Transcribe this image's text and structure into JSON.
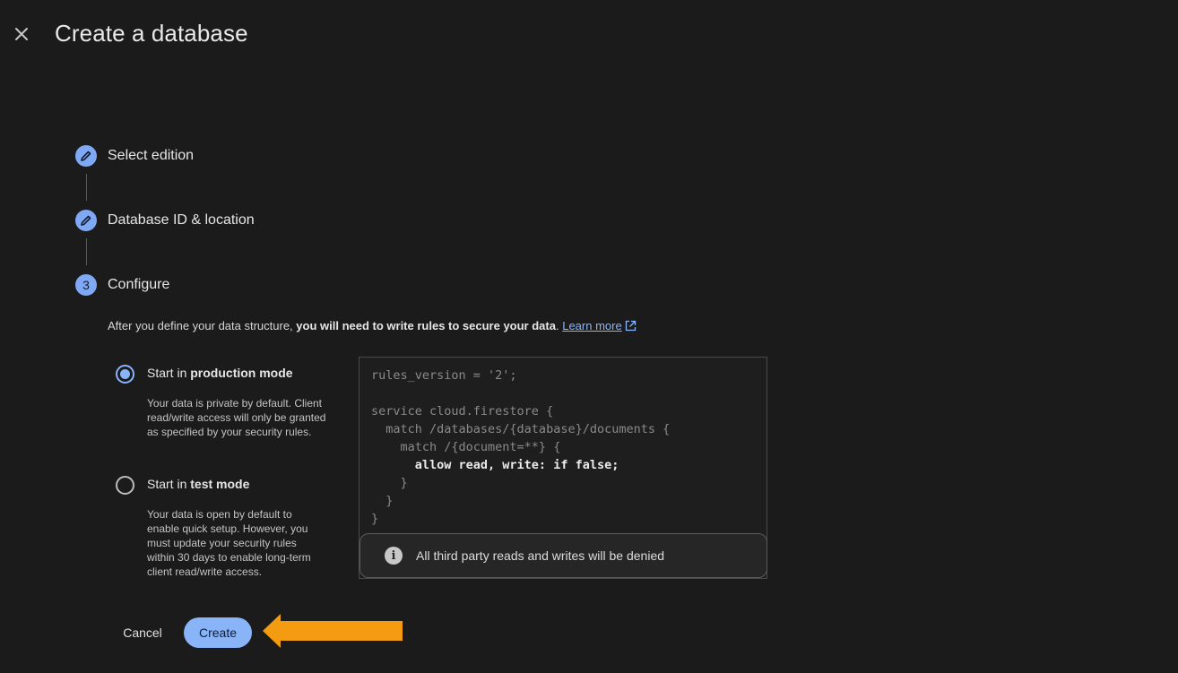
{
  "header": {
    "title": "Create a database"
  },
  "stepper": {
    "steps": [
      {
        "label": "Select edition",
        "state": "completed",
        "icon": "pencil-icon"
      },
      {
        "label": "Database ID & location",
        "state": "completed",
        "icon": "pencil-icon"
      },
      {
        "label": "Configure",
        "state": "active",
        "number": "3"
      }
    ]
  },
  "configure": {
    "description_plain": "After you define your data structure, ",
    "description_bold": "you will need to write rules to secure your data",
    "description_end": ".",
    "learn_more": "Learn more",
    "options": [
      {
        "title_prefix": "Start in ",
        "title_bold": "production mode",
        "selected": true,
        "description": "Your data is private by default. Client read/write access will only be granted as specified by your security rules."
      },
      {
        "title_prefix": "Start in ",
        "title_bold": "test mode",
        "selected": false,
        "description": "Your data is open by default to enable quick setup. However, you must update your security rules within 30 days to enable long-term client read/write access."
      }
    ],
    "code": {
      "lines": [
        "rules_version = '2';",
        "",
        "service cloud.firestore {",
        "  match /databases/{database}/documents {",
        "    match /{document=**} {",
        "      allow read, write: if false;",
        "    }",
        "  }",
        "}"
      ]
    },
    "info_message": "All third party reads and writes will be denied"
  },
  "actions": {
    "cancel_label": "Cancel",
    "create_label": "Create"
  },
  "colors": {
    "accent": "#8ab4f8",
    "arrow": "#f39c12",
    "background": "#1b1b1b"
  }
}
